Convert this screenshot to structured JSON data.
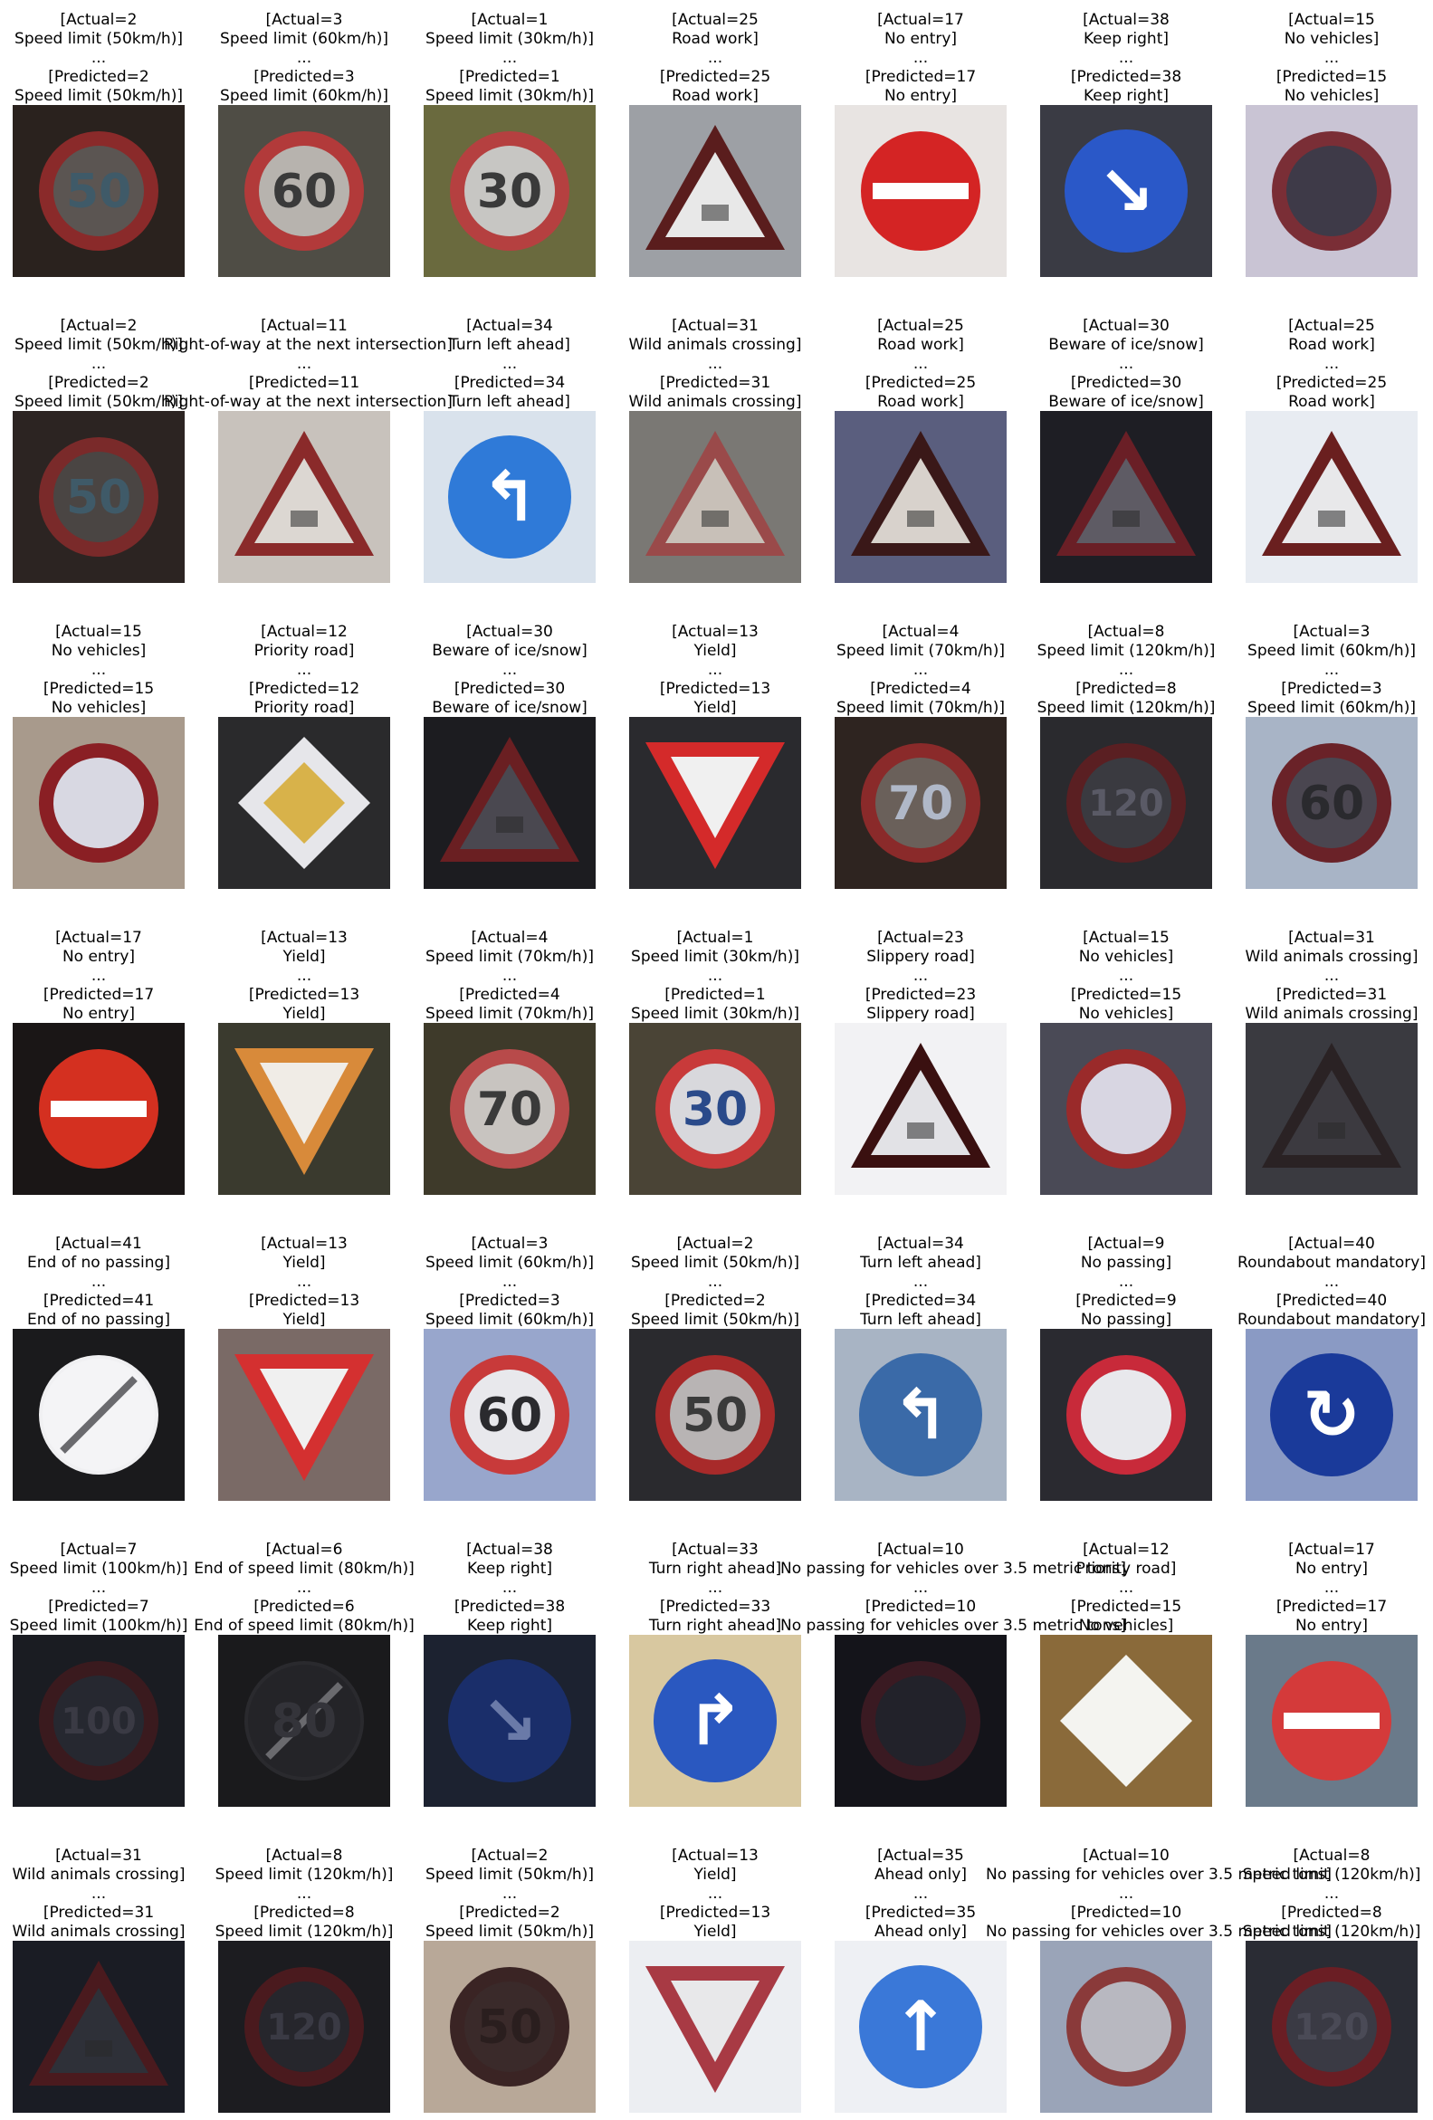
{
  "cells": [
    {
      "actual": "[Actual=2",
      "actual_name": "Speed limit (50km/h)]",
      "dots": "...",
      "pred": "[Predicted=2",
      "pred_name": "Speed limit (50km/h)]",
      "icon": "speed-limit-50-sign",
      "shape": "circle",
      "bg": "#2a221e",
      "ring": "#8a2a2a",
      "fill": "#5b5552",
      "text": "50",
      "text_color": "#3f5a68"
    },
    {
      "actual": "[Actual=3",
      "actual_name": "Speed limit (60km/h)]",
      "dots": "...",
      "pred": "[Predicted=3",
      "pred_name": "Speed limit (60km/h)]",
      "icon": "speed-limit-60-sign",
      "shape": "circle",
      "bg": "#4f4d45",
      "ring": "#b23a3a",
      "fill": "#b7b3ae",
      "text": "60",
      "text_color": "#3a3a3a"
    },
    {
      "actual": "[Actual=1",
      "actual_name": "Speed limit (30km/h)]",
      "dots": "...",
      "pred": "[Predicted=1",
      "pred_name": "Speed limit (30km/h)]",
      "icon": "speed-limit-30-sign",
      "shape": "circle",
      "bg": "#6a6a3e",
      "ring": "#b54040",
      "fill": "#c7c6c3",
      "text": "30",
      "text_color": "#3a3a3a"
    },
    {
      "actual": "[Actual=25",
      "actual_name": "Road work]",
      "dots": "...",
      "pred": "[Predicted=25",
      "pred_name": "Road work]",
      "icon": "road-work-sign",
      "shape": "triangle",
      "bg": "#9da0a5",
      "ring": "#5a1d1d",
      "fill": "#e8e8e8",
      "text": "",
      "text_color": "#222"
    },
    {
      "actual": "[Actual=17",
      "actual_name": "No entry]",
      "dots": "...",
      "pred": "[Predicted=17",
      "pred_name": "No entry]",
      "icon": "no-entry-sign",
      "shape": "noentry",
      "bg": "#e8e4e2",
      "ring": "#d42424",
      "fill": "#d42424",
      "text": "",
      "text_color": "#fff"
    },
    {
      "actual": "[Actual=38",
      "actual_name": "Keep right]",
      "dots": "...",
      "pred": "[Predicted=38",
      "pred_name": "Keep right]",
      "icon": "keep-right-sign",
      "shape": "bluecircle",
      "bg": "#3a3b44",
      "ring": "#2a58c8",
      "fill": "#2a58c8",
      "text": "↘",
      "text_color": "#fff"
    },
    {
      "actual": "[Actual=15",
      "actual_name": "No vehicles]",
      "dots": "...",
      "pred": "[Predicted=15",
      "pred_name": "No vehicles]",
      "icon": "no-vehicles-sign",
      "shape": "circle",
      "bg": "#c9c4d4",
      "ring": "#7a2e36",
      "fill": "#3e3a48",
      "text": "",
      "text_color": "#fff"
    },
    {
      "actual": "[Actual=2",
      "actual_name": "Speed limit (50km/h)]",
      "dots": "...",
      "pred": "[Predicted=2",
      "pred_name": "Speed limit (50km/h)]",
      "icon": "speed-limit-50-sign",
      "shape": "circle",
      "bg": "#2c2422",
      "ring": "#7a2a2a",
      "fill": "#4a4543",
      "text": "50",
      "text_color": "#3f5a68"
    },
    {
      "actual": "[Actual=11",
      "actual_name": "Right-of-way at the next intersection]",
      "dots": "...",
      "pred": "[Predicted=11",
      "pred_name": "Right-of-way at the next intersection]",
      "icon": "right-of-way-sign",
      "shape": "triangle",
      "bg": "#c8c2bc",
      "ring": "#8a2a2a",
      "fill": "#dcd7d2",
      "text": "",
      "text_color": "#222"
    },
    {
      "actual": "[Actual=34",
      "actual_name": "Turn left ahead]",
      "dots": "...",
      "pred": "[Predicted=34",
      "pred_name": "Turn left ahead]",
      "icon": "turn-left-ahead-sign",
      "shape": "bluecircle",
      "bg": "#d9e2ec",
      "ring": "#2f7ad8",
      "fill": "#2f7ad8",
      "text": "↰",
      "text_color": "#fff"
    },
    {
      "actual": "[Actual=31",
      "actual_name": "Wild animals crossing]",
      "dots": "...",
      "pred": "[Predicted=31",
      "pred_name": "Wild animals crossing]",
      "icon": "wild-animals-crossing-sign",
      "shape": "triangle",
      "bg": "#7a7874",
      "ring": "#9a4a4a",
      "fill": "#c8c0b8",
      "text": "",
      "text_color": "#222"
    },
    {
      "actual": "[Actual=25",
      "actual_name": "Road work]",
      "dots": "...",
      "pred": "[Predicted=25",
      "pred_name": "Road work]",
      "icon": "road-work-sign",
      "shape": "triangle",
      "bg": "#5a5e7e",
      "ring": "#3a1818",
      "fill": "#d8d2cc",
      "text": "",
      "text_color": "#222"
    },
    {
      "actual": "[Actual=30",
      "actual_name": "Beware of ice/snow]",
      "dots": "...",
      "pred": "[Predicted=30",
      "pred_name": "Beware of ice/snow]",
      "icon": "beware-ice-snow-sign",
      "shape": "triangle",
      "bg": "#1e1e24",
      "ring": "#6a1f26",
      "fill": "#5e5b64",
      "text": "",
      "text_color": "#222"
    },
    {
      "actual": "[Actual=25",
      "actual_name": "Road work]",
      "dots": "...",
      "pred": "[Predicted=25",
      "pred_name": "Road work]",
      "icon": "road-work-sign",
      "shape": "triangle",
      "bg": "#e8ecf2",
      "ring": "#6a1f1f",
      "fill": "#e8e8ea",
      "text": "",
      "text_color": "#222"
    },
    {
      "actual": "[Actual=15",
      "actual_name": "No vehicles]",
      "dots": "...",
      "pred": "[Predicted=15",
      "pred_name": "No vehicles]",
      "icon": "no-vehicles-sign",
      "shape": "circle",
      "bg": "#a89a8c",
      "ring": "#8a1f24",
      "fill": "#d8d8e2",
      "text": "",
      "text_color": "#fff"
    },
    {
      "actual": "[Actual=12",
      "actual_name": "Priority road]",
      "dots": "...",
      "pred": "[Predicted=12",
      "pred_name": "Priority road]",
      "icon": "priority-road-sign",
      "shape": "diamond",
      "bg": "#2a2a2c",
      "ring": "#e6e6ea",
      "fill": "#d8b24a",
      "text": "",
      "text_color": "#222"
    },
    {
      "actual": "[Actual=30",
      "actual_name": "Beware of ice/snow]",
      "dots": "...",
      "pred": "[Predicted=30",
      "pred_name": "Beware of ice/snow]",
      "icon": "beware-ice-snow-sign",
      "shape": "triangle",
      "bg": "#1c1c20",
      "ring": "#6a1f22",
      "fill": "#4a4850",
      "text": "",
      "text_color": "#222"
    },
    {
      "actual": "[Actual=13",
      "actual_name": "Yield]",
      "dots": "...",
      "pred": "[Predicted=13",
      "pred_name": "Yield]",
      "icon": "yield-sign",
      "shape": "yield",
      "bg": "#2a2a2e",
      "ring": "#d42a2a",
      "fill": "#f0f0f0",
      "text": "",
      "text_color": "#222"
    },
    {
      "actual": "[Actual=4",
      "actual_name": "Speed limit (70km/h)]",
      "dots": "...",
      "pred": "[Predicted=4",
      "pred_name": "Speed limit (70km/h)]",
      "icon": "speed-limit-70-sign",
      "shape": "circle",
      "bg": "#2e2420",
      "ring": "#8a2a2a",
      "fill": "#6a605a",
      "text": "70",
      "text_color": "#b0b8c8"
    },
    {
      "actual": "[Actual=8",
      "actual_name": "Speed limit (120km/h)]",
      "dots": "...",
      "pred": "[Predicted=8",
      "pred_name": "Speed limit (120km/h)]",
      "icon": "speed-limit-120-sign",
      "shape": "circle",
      "bg": "#2a2a2e",
      "ring": "#5a1f22",
      "fill": "#3a3a40",
      "text": "120",
      "text_color": "#5a5a66"
    },
    {
      "actual": "[Actual=3",
      "actual_name": "Speed limit (60km/h)]",
      "dots": "...",
      "pred": "[Predicted=3",
      "pred_name": "Speed limit (60km/h)]",
      "icon": "speed-limit-60-sign",
      "shape": "circle",
      "bg": "#a8b4c6",
      "ring": "#6a2228",
      "fill": "#4a4650",
      "text": "60",
      "text_color": "#2a2a2e"
    },
    {
      "actual": "[Actual=17",
      "actual_name": "No entry]",
      "dots": "...",
      "pred": "[Predicted=17",
      "pred_name": "No entry]",
      "icon": "no-entry-sign",
      "shape": "noentry",
      "bg": "#1a1616",
      "ring": "#d43020",
      "fill": "#d43020",
      "text": "",
      "text_color": "#fff"
    },
    {
      "actual": "[Actual=13",
      "actual_name": "Yield]",
      "dots": "...",
      "pred": "[Predicted=13",
      "pred_name": "Yield]",
      "icon": "yield-sign",
      "shape": "yield",
      "bg": "#3a3a2e",
      "ring": "#d88a3a",
      "fill": "#f0ece6",
      "text": "",
      "text_color": "#222"
    },
    {
      "actual": "[Actual=4",
      "actual_name": "Speed limit (70km/h)]",
      "dots": "...",
      "pred": "[Predicted=4",
      "pred_name": "Speed limit (70km/h)]",
      "icon": "speed-limit-70-sign",
      "shape": "circle",
      "bg": "#3e3a2a",
      "ring": "#b84a4a",
      "fill": "#c8c4c0",
      "text": "70",
      "text_color": "#3a3a3a"
    },
    {
      "actual": "[Actual=1",
      "actual_name": "Speed limit (30km/h)]",
      "dots": "...",
      "pred": "[Predicted=1",
      "pred_name": "Speed limit (30km/h)]",
      "icon": "speed-limit-30-sign",
      "shape": "circle",
      "bg": "#4a4436",
      "ring": "#c83a3a",
      "fill": "#d8d8dc",
      "text": "30",
      "text_color": "#2a4a8a"
    },
    {
      "actual": "[Actual=23",
      "actual_name": "Slippery road]",
      "dots": "...",
      "pred": "[Predicted=23",
      "pred_name": "Slippery road]",
      "icon": "slippery-road-sign",
      "shape": "triangle",
      "bg": "#f2f2f4",
      "ring": "#3a1010",
      "fill": "#e2e2e6",
      "text": "",
      "text_color": "#222"
    },
    {
      "actual": "[Actual=15",
      "actual_name": "No vehicles]",
      "dots": "...",
      "pred": "[Predicted=15",
      "pred_name": "No vehicles]",
      "icon": "no-vehicles-sign",
      "shape": "circle",
      "bg": "#4a4a56",
      "ring": "#9a2a2a",
      "fill": "#d8d6e2",
      "text": "",
      "text_color": "#fff"
    },
    {
      "actual": "[Actual=31",
      "actual_name": "Wild animals crossing]",
      "dots": "...",
      "pred": "[Predicted=31",
      "pred_name": "Wild animals crossing]",
      "icon": "wild-animals-crossing-sign",
      "shape": "triangle",
      "bg": "#3a3a40",
      "ring": "#2a2224",
      "fill": "#3c3a40",
      "text": "",
      "text_color": "#222"
    },
    {
      "actual": "[Actual=41",
      "actual_name": "End of no passing]",
      "dots": "...",
      "pred": "[Predicted=41",
      "pred_name": "End of no passing]",
      "icon": "end-of-no-passing-sign",
      "shape": "endcircle",
      "bg": "#1a1a1c",
      "ring": "#f0f0f2",
      "fill": "#f4f4f6",
      "text": "",
      "text_color": "#444"
    },
    {
      "actual": "[Actual=13",
      "actual_name": "Yield]",
      "dots": "...",
      "pred": "[Predicted=13",
      "pred_name": "Yield]",
      "icon": "yield-sign",
      "shape": "yield",
      "bg": "#7a6a66",
      "ring": "#d43030",
      "fill": "#f0f0f0",
      "text": "",
      "text_color": "#222"
    },
    {
      "actual": "[Actual=3",
      "actual_name": "Speed limit (60km/h)]",
      "dots": "...",
      "pred": "[Predicted=3",
      "pred_name": "Speed limit (60km/h)]",
      "icon": "speed-limit-60-sign",
      "shape": "circle",
      "bg": "#98a6cc",
      "ring": "#c83a3a",
      "fill": "#e8e8ec",
      "text": "60",
      "text_color": "#2a2a2e"
    },
    {
      "actual": "[Actual=2",
      "actual_name": "Speed limit (50km/h)]",
      "dots": "...",
      "pred": "[Predicted=2",
      "pred_name": "Speed limit (50km/h)]",
      "icon": "speed-limit-50-sign",
      "shape": "circle",
      "bg": "#2a2a2e",
      "ring": "#a82a2a",
      "fill": "#b8b4b4",
      "text": "50",
      "text_color": "#3a3a3a"
    },
    {
      "actual": "[Actual=34",
      "actual_name": "Turn left ahead]",
      "dots": "...",
      "pred": "[Predicted=34",
      "pred_name": "Turn left ahead]",
      "icon": "turn-left-ahead-sign",
      "shape": "bluecircle",
      "bg": "#a8b4c4",
      "ring": "#3a6aa8",
      "fill": "#3a6aa8",
      "text": "↰",
      "text_color": "#fff"
    },
    {
      "actual": "[Actual=9",
      "actual_name": "No passing]",
      "dots": "...",
      "pred": "[Predicted=9",
      "pred_name": "No passing]",
      "icon": "no-passing-sign",
      "shape": "circle",
      "bg": "#2a2a30",
      "ring": "#c82a3a",
      "fill": "#e8e8ec",
      "text": "",
      "text_color": "#222"
    },
    {
      "actual": "[Actual=40",
      "actual_name": "Roundabout mandatory]",
      "dots": "...",
      "pred": "[Predicted=40",
      "pred_name": "Roundabout mandatory]",
      "icon": "roundabout-mandatory-sign",
      "shape": "bluecircle",
      "bg": "#8a9ac4",
      "ring": "#1a3a9a",
      "fill": "#1a3a9a",
      "text": "↻",
      "text_color": "#fff"
    },
    {
      "actual": "[Actual=7",
      "actual_name": "Speed limit (100km/h)]",
      "dots": "...",
      "pred": "[Predicted=7",
      "pred_name": "Speed limit (100km/h)]",
      "icon": "speed-limit-100-sign",
      "shape": "circle",
      "bg": "#1a1c22",
      "ring": "#3a1a1e",
      "fill": "#262830",
      "text": "100",
      "text_color": "#3a3a44"
    },
    {
      "actual": "[Actual=6",
      "actual_name": "End of speed limit (80km/h)]",
      "dots": "...",
      "pred": "[Predicted=6",
      "pred_name": "End of speed limit (80km/h)]",
      "icon": "end-of-speed-limit-80-sign",
      "shape": "endcircle",
      "bg": "#1a1a1c",
      "ring": "#2a2a2e",
      "fill": "#242428",
      "text": "80",
      "text_color": "#34343a"
    },
    {
      "actual": "[Actual=38",
      "actual_name": "Keep right]",
      "dots": "...",
      "pred": "[Predicted=38",
      "pred_name": "Keep right]",
      "icon": "keep-right-sign",
      "shape": "bluecircle",
      "bg": "#1c2230",
      "ring": "#1a2e6a",
      "fill": "#1a2e6a",
      "text": "↘",
      "text_color": "#6a7aa8"
    },
    {
      "actual": "[Actual=33",
      "actual_name": "Turn right ahead]",
      "dots": "...",
      "pred": "[Predicted=33",
      "pred_name": "Turn right ahead]",
      "icon": "turn-right-ahead-sign",
      "shape": "bluecircle",
      "bg": "#d8c8a0",
      "ring": "#2a58c0",
      "fill": "#2a58c0",
      "text": "↱",
      "text_color": "#fff"
    },
    {
      "actual": "[Actual=10",
      "actual_name": "No passing for vehicles over 3.5 metric tons]",
      "dots": "...",
      "pred": "[Predicted=10",
      "pred_name": "No passing for vehicles over 3.5 metric tons]",
      "icon": "no-passing-heavy-vehicles-sign",
      "shape": "circle",
      "bg": "#14141a",
      "ring": "#3a1a22",
      "fill": "#22222a",
      "text": "",
      "text_color": "#444"
    },
    {
      "actual": "[Actual=12",
      "actual_name": "Priority road]",
      "dots": "...",
      "pred": "[Predicted=15",
      "pred_name": "No vehicles]",
      "icon": "priority-road-sign",
      "shape": "diamond",
      "bg": "#8a6a3a",
      "ring": "#f4f4f0",
      "fill": "#f4f4f0",
      "text": "",
      "text_color": "#222"
    },
    {
      "actual": "[Actual=17",
      "actual_name": "No entry]",
      "dots": "...",
      "pred": "[Predicted=17",
      "pred_name": "No entry]",
      "icon": "no-entry-sign",
      "shape": "noentry",
      "bg": "#6a7a8a",
      "ring": "#d43a3a",
      "fill": "#d43a3a",
      "text": "",
      "text_color": "#fff"
    },
    {
      "actual": "[Actual=31",
      "actual_name": "Wild animals crossing]",
      "dots": "...",
      "pred": "[Predicted=31",
      "pred_name": "Wild animals crossing]",
      "icon": "wild-animals-crossing-sign",
      "shape": "triangle",
      "bg": "#1a1c24",
      "ring": "#4a1a1e",
      "fill": "#2e3038",
      "text": "",
      "text_color": "#222"
    },
    {
      "actual": "[Actual=8",
      "actual_name": "Speed limit (120km/h)]",
      "dots": "...",
      "pred": "[Predicted=8",
      "pred_name": "Speed limit (120km/h)]",
      "icon": "speed-limit-120-sign",
      "shape": "circle",
      "bg": "#1c1c20",
      "ring": "#4a1a1e",
      "fill": "#26262c",
      "text": "120",
      "text_color": "#3a3a44"
    },
    {
      "actual": "[Actual=2",
      "actual_name": "Speed limit (50km/h)]",
      "dots": "...",
      "pred": "[Predicted=2",
      "pred_name": "Speed limit (50km/h)]",
      "icon": "speed-limit-50-sign",
      "shape": "circle",
      "bg": "#b8a898",
      "ring": "#3a2424",
      "fill": "#3a2a2a",
      "text": "50",
      "text_color": "#2a1e1e"
    },
    {
      "actual": "[Actual=13",
      "actual_name": "Yield]",
      "dots": "...",
      "pred": "[Predicted=13",
      "pred_name": "Yield]",
      "icon": "yield-sign",
      "shape": "yield",
      "bg": "#eceef2",
      "ring": "#a83a44",
      "fill": "#e8e8ea",
      "text": "",
      "text_color": "#222"
    },
    {
      "actual": "[Actual=35",
      "actual_name": "Ahead only]",
      "dots": "...",
      "pred": "[Predicted=35",
      "pred_name": "Ahead only]",
      "icon": "ahead-only-sign",
      "shape": "bluecircle",
      "bg": "#eef0f4",
      "ring": "#3a78d8",
      "fill": "#3a78d8",
      "text": "↑",
      "text_color": "#fff"
    },
    {
      "actual": "[Actual=10",
      "actual_name": "No passing for vehicles over 3.5 metric tons]",
      "dots": "...",
      "pred": "[Predicted=10",
      "pred_name": "No passing for vehicles over 3.5 metric tons]",
      "icon": "no-passing-heavy-vehicles-sign",
      "shape": "circle",
      "bg": "#9aa4b8",
      "ring": "#8a3a3a",
      "fill": "#b8b8c0",
      "text": "",
      "text_color": "#444"
    },
    {
      "actual": "[Actual=8",
      "actual_name": "Speed limit (120km/h)]",
      "dots": "...",
      "pred": "[Predicted=8",
      "pred_name": "Speed limit (120km/h)]",
      "icon": "speed-limit-120-sign",
      "shape": "circle",
      "bg": "#2a2c34",
      "ring": "#6a1e24",
      "fill": "#3a3a44",
      "text": "120",
      "text_color": "#4a4a56"
    }
  ]
}
